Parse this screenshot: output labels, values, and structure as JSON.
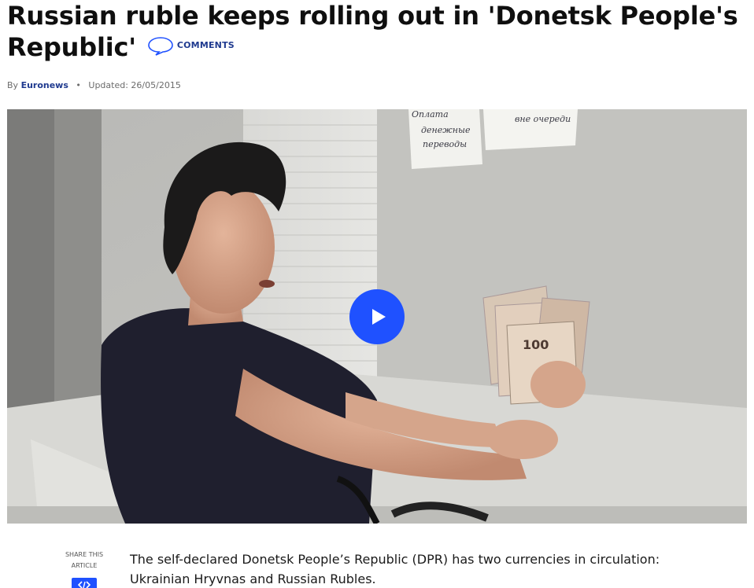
{
  "article": {
    "title": "Russian ruble keeps rolling out in 'Donetsk People's Republic'",
    "comments_label": "COMMENTS",
    "byline": {
      "by": "By",
      "author": "Euronews",
      "separator": "•",
      "updated_label": "Updated:",
      "updated_date": "26/05/2015"
    },
    "video": {
      "sign_left": [
        "Оплата",
        "денежные",
        "переводы"
      ],
      "sign_right": [
        "вне очереди"
      ],
      "banknote_value": "100"
    },
    "share_label": "SHARE THIS ARTICLE",
    "body_first_paragraph": "The self-declared Donetsk People’s Republic (DPR) has two currencies in circulation: Ukrainian Hryvnas and Russian Rubles."
  },
  "colors": {
    "accent_blue": "#1f51ff",
    "link_blue": "#1f3a8f"
  }
}
